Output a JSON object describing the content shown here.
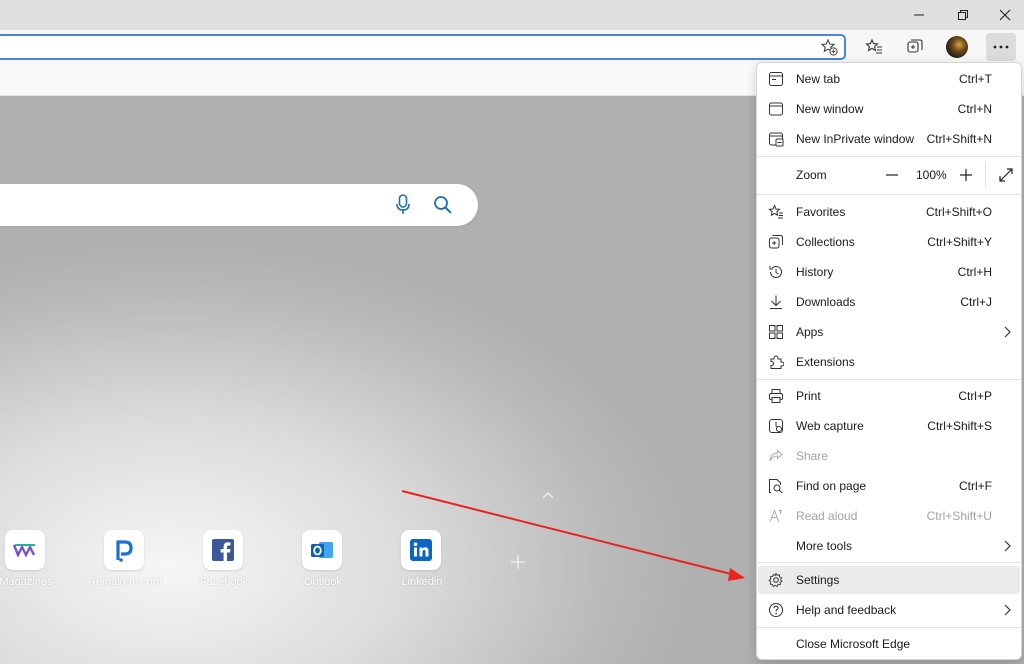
{
  "search": {
    "mic_icon": "microphone-icon",
    "search_icon": "search-icon"
  },
  "quick_links": [
    {
      "label": "Magazines"
    },
    {
      "label": "Remaloan.com"
    },
    {
      "label": "Facebook"
    },
    {
      "label": "Outlook"
    },
    {
      "label": "Linkedin"
    }
  ],
  "menu": {
    "new_tab": {
      "label": "New tab",
      "shortcut": "Ctrl+T"
    },
    "new_window": {
      "label": "New window",
      "shortcut": "Ctrl+N"
    },
    "new_inprivate": {
      "label": "New InPrivate window",
      "shortcut": "Ctrl+Shift+N"
    },
    "zoom": {
      "label": "Zoom",
      "value": "100%"
    },
    "favorites": {
      "label": "Favorites",
      "shortcut": "Ctrl+Shift+O"
    },
    "collections": {
      "label": "Collections",
      "shortcut": "Ctrl+Shift+Y"
    },
    "history": {
      "label": "History",
      "shortcut": "Ctrl+H"
    },
    "downloads": {
      "label": "Downloads",
      "shortcut": "Ctrl+J"
    },
    "apps": {
      "label": "Apps"
    },
    "extensions": {
      "label": "Extensions"
    },
    "print": {
      "label": "Print",
      "shortcut": "Ctrl+P"
    },
    "web_capture": {
      "label": "Web capture",
      "shortcut": "Ctrl+Shift+S"
    },
    "share": {
      "label": "Share"
    },
    "find_on_page": {
      "label": "Find on page",
      "shortcut": "Ctrl+F"
    },
    "read_aloud": {
      "label": "Read aloud",
      "shortcut": "Ctrl+Shift+U"
    },
    "more_tools": {
      "label": "More tools"
    },
    "settings": {
      "label": "Settings"
    },
    "help_feedback": {
      "label": "Help and feedback"
    },
    "close_edge": {
      "label": "Close Microsoft Edge"
    }
  },
  "colors": {
    "accent_blue": "#4a87d8",
    "annotation_arrow": "#e8231b",
    "menu_highlight": "#ebebeb"
  }
}
